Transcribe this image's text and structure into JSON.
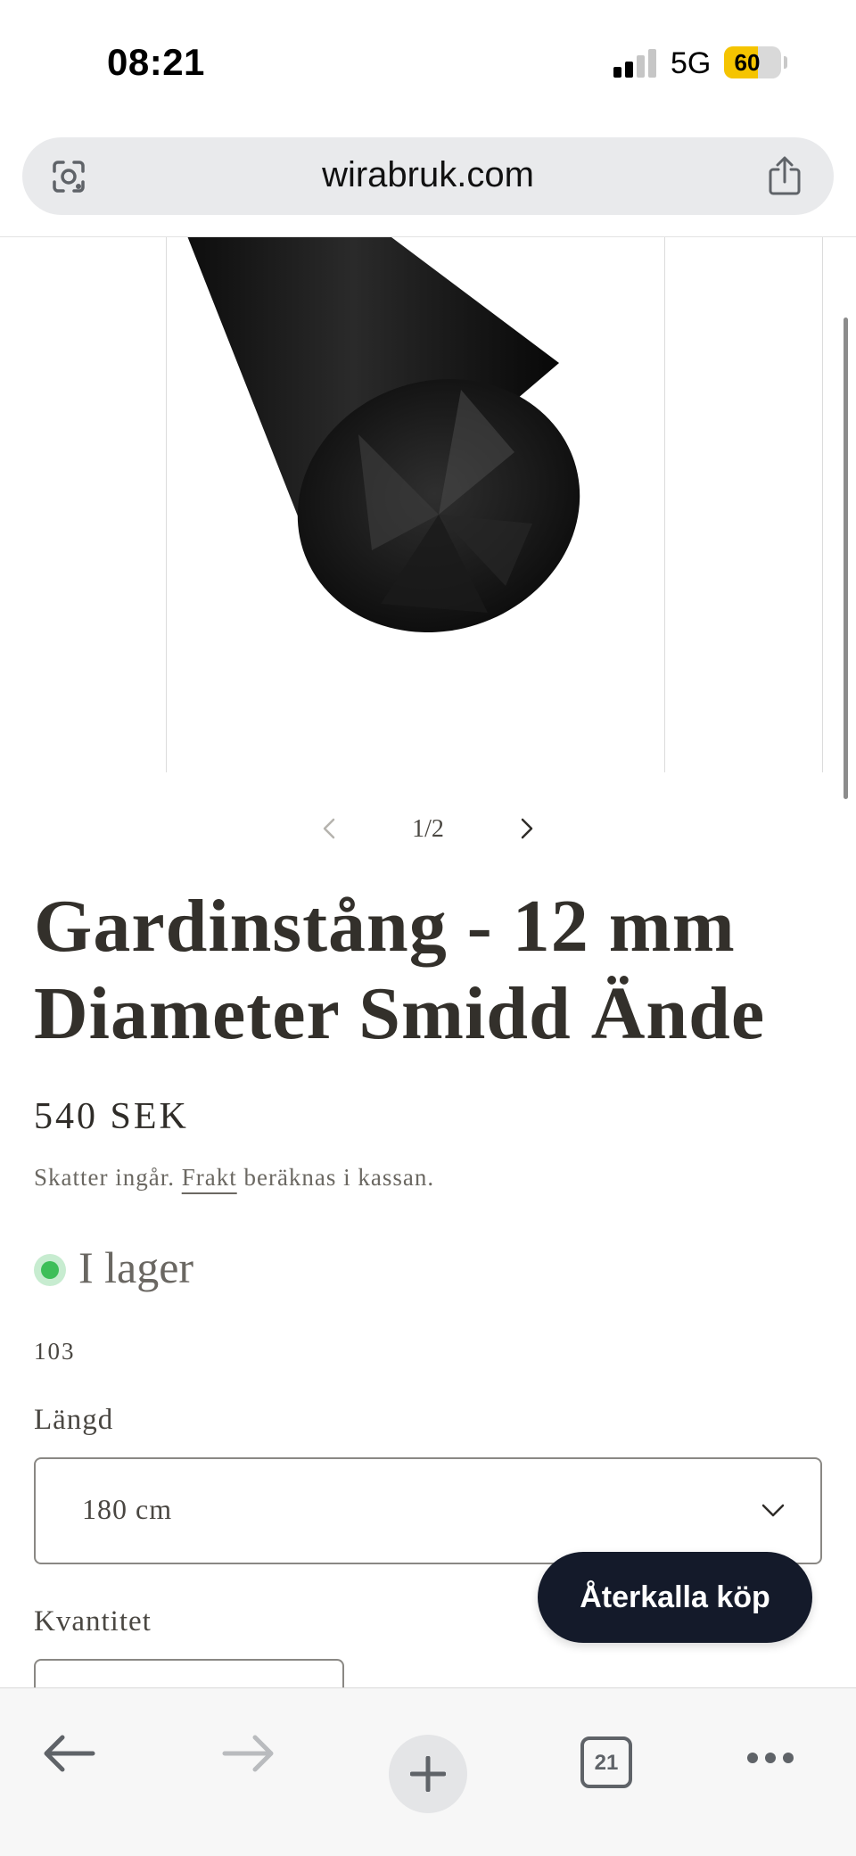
{
  "status_bar": {
    "time": "08:21",
    "network": "5G",
    "battery": "60",
    "battery_level": 0.6,
    "signal_bars": 2
  },
  "browser": {
    "url": "wirabruk.com",
    "lens_icon": "google-lens-icon",
    "share_icon": "share-icon"
  },
  "gallery": {
    "counter": "1/2",
    "current": 1,
    "total": 2,
    "image": "forged-curtain-rod-end"
  },
  "product": {
    "title": "Gardinstång - 12 mm Diameter Smidd Ände",
    "price": "540 SEK",
    "tax_prefix": "Skatter ingår.",
    "shipping_link": "Frakt",
    "tax_suffix": "beräknas i kassan.",
    "stock_status": "I lager",
    "stock_color": "#3ebe59",
    "sku": "103",
    "length_label": "Längd",
    "length_value": "180 cm",
    "quantity_label": "Kvantitet"
  },
  "floating_button": {
    "label": "Återkalla köp",
    "color": "#141a2a"
  },
  "toolbar": {
    "tab_count": "21",
    "icons": [
      "back-arrow-icon",
      "forward-arrow-icon",
      "new-tab-icon",
      "tab-switcher-icon",
      "more-icon"
    ]
  }
}
